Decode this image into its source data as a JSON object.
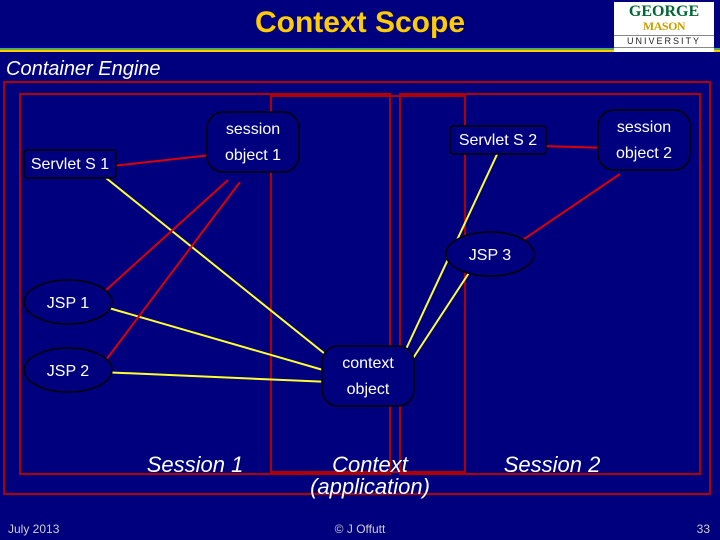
{
  "title": "Context Scope",
  "container_label": "Container Engine",
  "logo": {
    "line1": "GEORGE",
    "line2": "MASON",
    "line3": "UNIVERSITY"
  },
  "boxes": {
    "servlet_s1": "Servlet S 1",
    "servlet_s2": "Servlet S 2",
    "session_obj_left": {
      "top": "session",
      "bottom": "object 1"
    },
    "session_obj_right": {
      "top": "session",
      "bottom": "object 2"
    },
    "jsp1": "JSP 1",
    "jsp2": "JSP 2",
    "jsp3": "JSP 3",
    "context_obj": {
      "top": "context",
      "bottom": "object"
    },
    "session1_label": "Session 1",
    "session2_label": "Session 2",
    "context_app_1": "Context",
    "context_app_2": "(application)"
  },
  "footer": {
    "date": "July 2013",
    "copy": "© J Offutt",
    "page": "33"
  }
}
